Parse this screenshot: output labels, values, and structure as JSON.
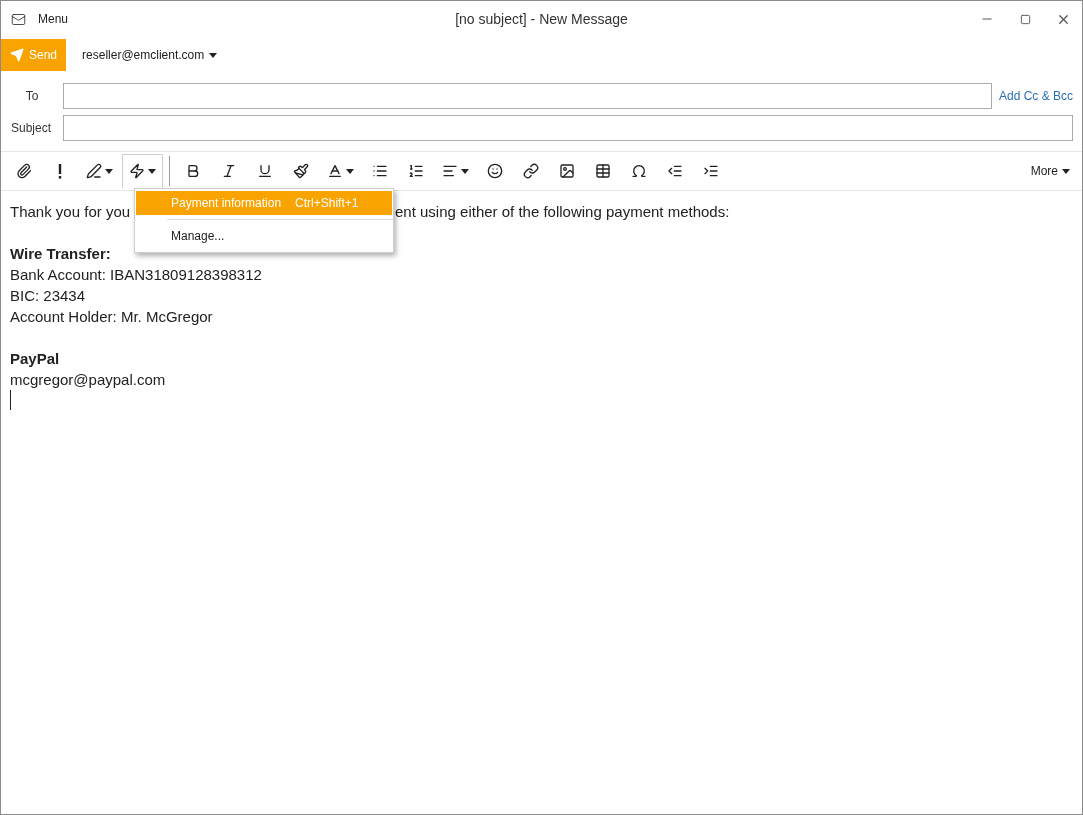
{
  "window": {
    "title": "[no subject] - New Message",
    "menu": "Menu"
  },
  "send": {
    "label": "Send",
    "account": "reseller@emclient.com"
  },
  "fields": [
    {
      "label": "To",
      "link": "Add Cc & Bcc"
    },
    {
      "label": "Subject"
    }
  ],
  "toolbar": {
    "items": [
      {
        "kind": "attach",
        "dropdown": false,
        "open": false
      },
      {
        "kind": "priority",
        "dropdown": false,
        "open": false
      },
      {
        "kind": "signature",
        "dropdown": true,
        "open": false
      },
      {
        "kind": "templates",
        "dropdown": true,
        "open": true
      },
      {
        "kind": "bold",
        "dropdown": false,
        "open": false
      },
      {
        "kind": "italic",
        "dropdown": false,
        "open": false
      },
      {
        "kind": "underline",
        "dropdown": false,
        "open": false
      },
      {
        "kind": "format-painter",
        "dropdown": false,
        "open": false
      },
      {
        "kind": "font",
        "dropdown": true,
        "open": false
      },
      {
        "kind": "bullets",
        "dropdown": false,
        "open": false
      },
      {
        "kind": "numbering",
        "dropdown": false,
        "open": false
      },
      {
        "kind": "align",
        "dropdown": true,
        "open": false
      },
      {
        "kind": "emoji",
        "dropdown": false,
        "open": false
      },
      {
        "kind": "link",
        "dropdown": false,
        "open": false
      },
      {
        "kind": "image",
        "dropdown": false,
        "open": false
      },
      {
        "kind": "table",
        "dropdown": false,
        "open": false
      },
      {
        "kind": "symbol",
        "dropdown": false,
        "open": false
      },
      {
        "kind": "outdent",
        "dropdown": false,
        "open": false
      },
      {
        "kind": "indent",
        "dropdown": false,
        "open": false
      }
    ],
    "more": "More"
  },
  "menu": [
    {
      "label": "Payment information",
      "shortcut": "Ctrl+Shift+1",
      "selected": true
    },
    {
      "label": "Manage...",
      "selected": false
    }
  ],
  "body": {
    "first_line": [
      "Thank you for you",
      "ent using either of the following payment methods:"
    ],
    "paragraphs": [
      [
        {
          "text": "Wire Transfer:",
          "bold": true
        },
        {
          "text": "Bank Account: IBAN31809128398312",
          "bold": false
        },
        {
          "text": "BIC: 23434",
          "bold": false
        },
        {
          "text": "Account Holder: Mr. McGregor",
          "bold": false
        }
      ],
      [
        {
          "text": "PayPal",
          "bold": true
        },
        {
          "text": "mcgregor@paypal.com",
          "bold": false
        }
      ]
    ]
  }
}
